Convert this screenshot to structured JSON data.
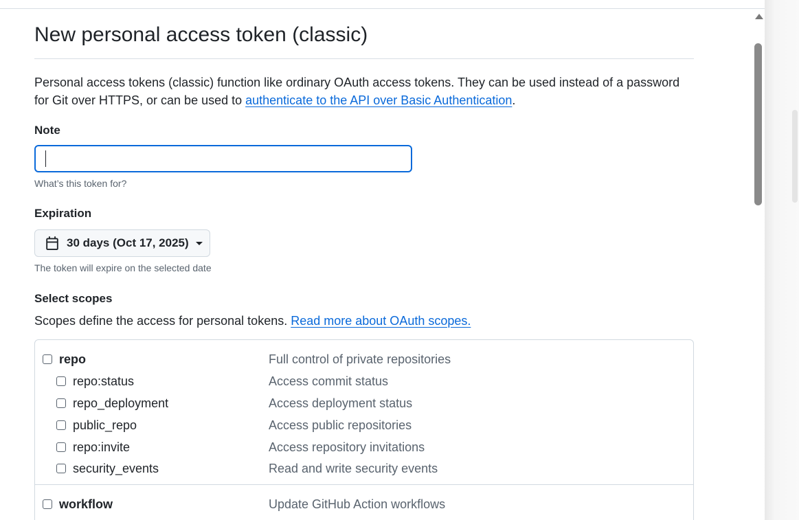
{
  "page": {
    "title": "New personal access token (classic)",
    "intro_text": "Personal access tokens (classic) function like ordinary OAuth access tokens. They can be used instead of a password for Git over HTTPS, or can be used to ",
    "intro_link": "authenticate to the API over Basic Authentication",
    "intro_end": "."
  },
  "note": {
    "label": "Note",
    "value": "",
    "placeholder": "",
    "hint": "What’s this token for?"
  },
  "expiration": {
    "label": "Expiration",
    "selected": "30 days (Oct 17, 2025)",
    "icon": "calendar-icon",
    "hint": "The token will expire on the selected date"
  },
  "scopes": {
    "label": "Select scopes",
    "description": "Scopes define the access for personal tokens. ",
    "link": "Read more about OAuth scopes.",
    "items": [
      {
        "name": "repo",
        "description": "Full control of private repositories",
        "checked": false
      },
      {
        "name": "repo:status",
        "description": "Access commit status",
        "checked": false
      },
      {
        "name": "repo_deployment",
        "description": "Access deployment status",
        "checked": false
      },
      {
        "name": "public_repo",
        "description": "Access public repositories",
        "checked": false
      },
      {
        "name": "repo:invite",
        "description": "Access repository invitations",
        "checked": false
      },
      {
        "name": "security_events",
        "description": "Read and write security events",
        "checked": false
      },
      {
        "name": "workflow",
        "description": "Update GitHub Action workflows",
        "checked": false
      }
    ]
  },
  "colors": {
    "link": "#0969da",
    "focus_border": "#0969da",
    "muted_text": "#59636e",
    "border": "#d1d9e0"
  }
}
